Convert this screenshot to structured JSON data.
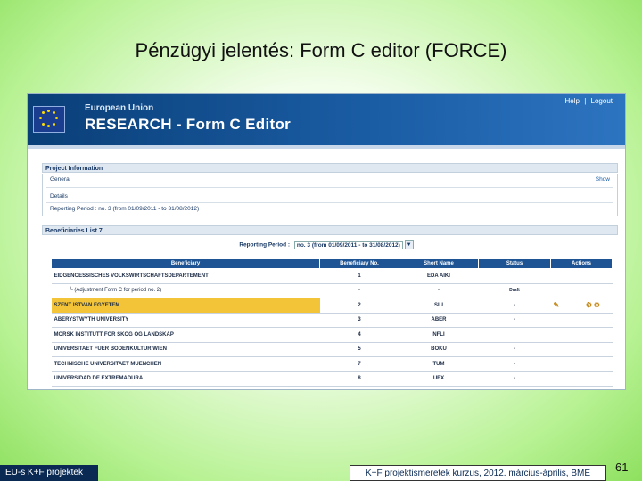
{
  "slide": {
    "title": "Pénzügyi jelentés: Form C editor (FORCE)",
    "footer_left": "EU-s K+F projektek",
    "footer_mid": "K+F projektismeretek kurzus, 2012. március-április, BME",
    "page_number": "61"
  },
  "app": {
    "banner_sub": "European Union",
    "banner_title": "RESEARCH - Form C Editor",
    "links": [
      "Help",
      "|",
      "Logout"
    ]
  },
  "project_info": {
    "header": "Project Information",
    "general": "General",
    "show": "Show",
    "details": "Details",
    "reporting_period": "Reporting Period : no. 3 (from 01/09/2011 - to 31/08/2012)"
  },
  "beneficiaries": {
    "header": "Beneficiaries List",
    "period_label": "Reporting Period :",
    "period_value": "no. 3 (from 01/09/2011 - to 31/08/2012)",
    "columns": [
      "Beneficiary",
      "Beneficiary No.",
      "Short Name",
      "Status",
      "Actions"
    ],
    "rows": [
      {
        "name": "EIDGENOESSISCHES VOLKSWIRTSCHAFTSDEPARTEMENT",
        "no": "1",
        "short": "EDA AIKI",
        "status": ""
      },
      {
        "name": "(Adjustment Form C for period no. 2)",
        "no": "-",
        "short": "-",
        "status": "Draft"
      },
      {
        "name": "SZENT ISTVAN EGYETEM",
        "no": "2",
        "short": "SIU",
        "status": "-"
      },
      {
        "name": "ABERYSTWYTH UNIVERSITY",
        "no": "3",
        "short": "ABER",
        "status": "-"
      },
      {
        "name": "MORSK INSTITUTT FOR SKOG OG LANDSKAP",
        "no": "4",
        "short": "NFLI",
        "status": ""
      },
      {
        "name": "UNIVERSITAET FUER BODENKULTUR WIEN",
        "no": "5",
        "short": "BOKU",
        "status": "-"
      },
      {
        "name": "TECHNISCHE UNIVERSITAET MUENCHEN",
        "no": "7",
        "short": "TUM",
        "status": "-"
      },
      {
        "name": "UNIVERSIDAD DE EXTREMADURA",
        "no": "8",
        "short": "UEX",
        "status": "-"
      }
    ]
  }
}
